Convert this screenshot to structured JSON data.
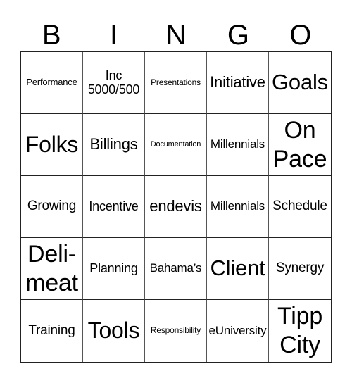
{
  "header": [
    "B",
    "I",
    "N",
    "G",
    "O"
  ],
  "cells": [
    "Performance",
    "Inc\n5000/500",
    "Presentations",
    "Initiative",
    "Goals",
    "Folks",
    "Billings",
    "Documentation",
    "Millennials",
    "On\nPace",
    "Growing",
    "Incentive",
    "endevis",
    "Millennials",
    "Schedule",
    "Deli-\nmeat",
    "Planning",
    "Bahama’s",
    "Client",
    "Synergy",
    "Training",
    "Tools",
    "Responsibility",
    "eUniversity",
    "Tipp\nCity"
  ]
}
